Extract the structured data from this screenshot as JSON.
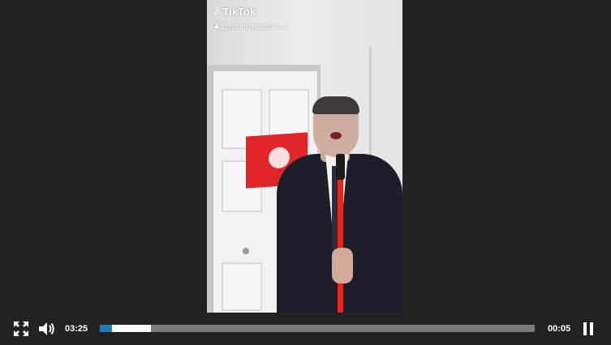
{
  "video": {
    "brand": "TikTok",
    "brand_icon": "tiktok-note-icon",
    "username": "@nourelhoudanaoui",
    "user_icon": "user-icon"
  },
  "controls": {
    "fullscreen_icon": "fullscreen-icon",
    "volume_icon": "volume-icon",
    "elapsed": "03:25",
    "remaining": "00:05",
    "pause_icon": "pause-icon",
    "played_fraction": 0.028,
    "buffered_fraction": 0.118,
    "colors": {
      "played": "#1a7bbf",
      "buffered": "#ffffff",
      "track": "#7a7a7a",
      "background": "#222222"
    }
  }
}
